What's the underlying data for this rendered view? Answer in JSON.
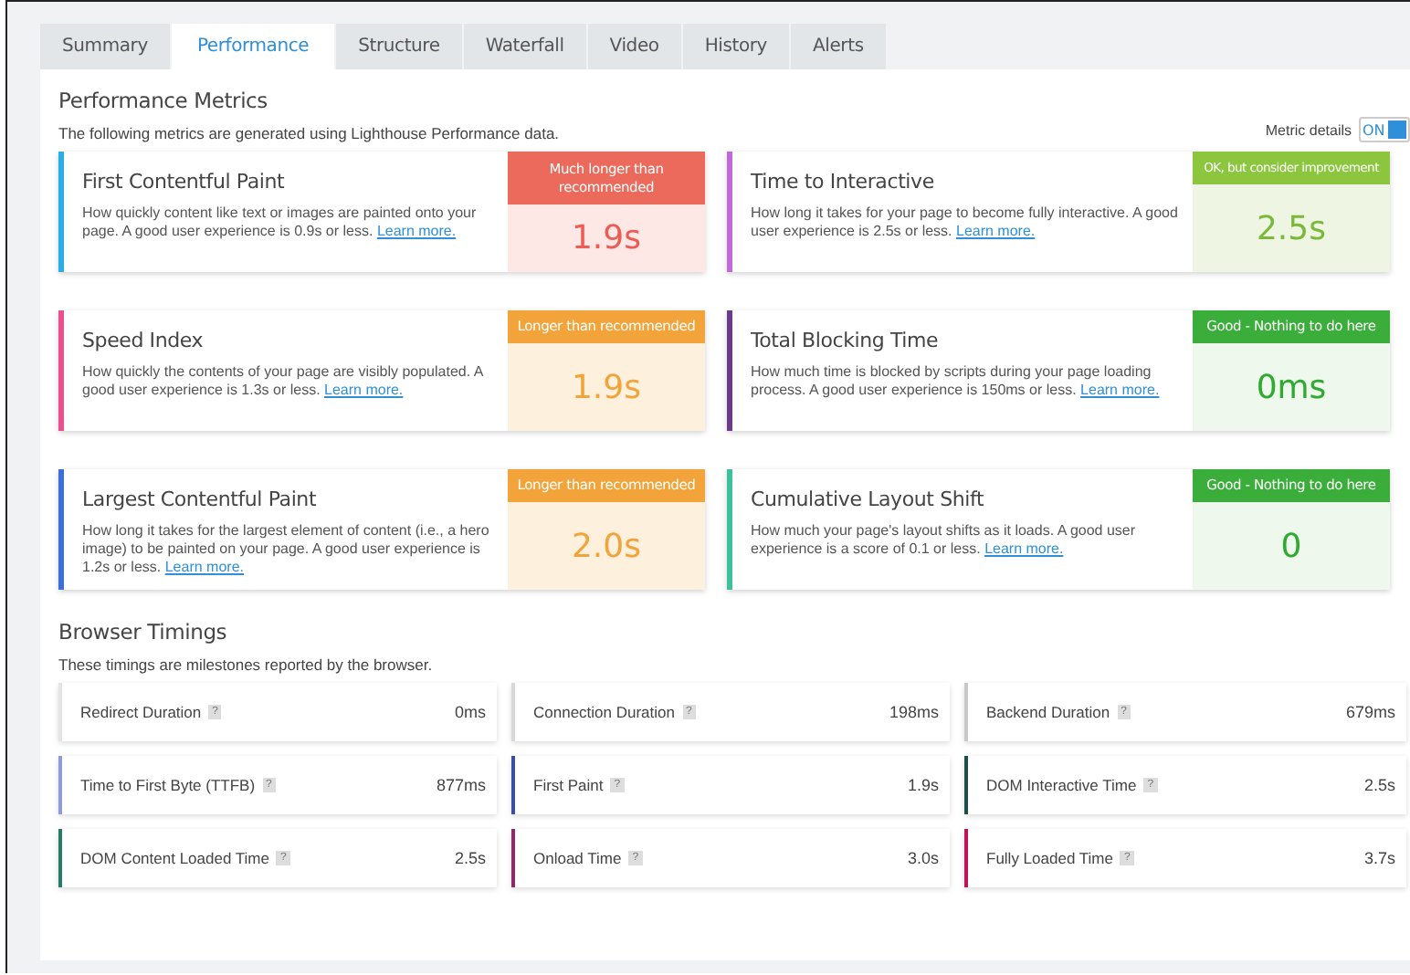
{
  "tabs": [
    {
      "label": "Summary",
      "selected": false
    },
    {
      "label": "Performance",
      "selected": true
    },
    {
      "label": "Structure",
      "selected": false
    },
    {
      "label": "Waterfall",
      "selected": false
    },
    {
      "label": "Video",
      "selected": false
    },
    {
      "label": "History",
      "selected": false
    },
    {
      "label": "Alerts",
      "selected": false
    }
  ],
  "metrics_section": {
    "title": "Performance Metrics",
    "subtitle": "The following metrics are generated using Lighthouse Performance data.",
    "toggle": {
      "label": "Metric details",
      "text": "ON",
      "on": true
    }
  },
  "metrics": [
    {
      "title": "First Contentful Paint",
      "description": "How quickly content like text or images are painted onto your page. A good user experience is 0.9s or less.",
      "link": "Learn more.",
      "color": "#29aee6",
      "kind": "bad",
      "status_label": "Much longer than recommended",
      "value": "1.9s"
    },
    {
      "title": "Time to Interactive",
      "description": "How long it takes for your page to become fully interactive. A good user experience is 2.5s or less.",
      "link": "Learn more.",
      "color": "#c06ad8",
      "kind": "fair",
      "status_label": "OK, but consider improvement",
      "value": "2.5s"
    },
    {
      "title": "Speed Index",
      "description": "How quickly the contents of your page are visibly populated. A good user experience is 1.3s or less.",
      "link": "Learn more.",
      "color": "#e8508f",
      "kind": "average",
      "status_label": "Longer than recommended",
      "value": "1.9s"
    },
    {
      "title": "Total Blocking Time",
      "description": "How much time is blocked by scripts during your page loading process. A good user experience is 150ms or less.",
      "link": "Learn more.",
      "color": "#6b3a8a",
      "kind": "good",
      "status_label": "Good - Nothing to do here",
      "value": "0ms"
    },
    {
      "title": "Largest Contentful Paint",
      "description": "How long it takes for the largest element of content (i.e., a hero image) to be painted on your page. A good user experience is 1.2s or less.",
      "link": "Learn more.",
      "color": "#3d6fd8",
      "kind": "average",
      "status_label": "Longer than recommended",
      "value": "2.0s"
    },
    {
      "title": "Cumulative Layout Shift",
      "description": "How much your page's layout shifts as it loads. A good user experience is a score of 0.1 or less.",
      "link": "Learn more.",
      "color": "#3dc19a",
      "kind": "good",
      "status_label": "Good - Nothing to do here",
      "value": "0"
    }
  ],
  "timings_section": {
    "title": "Browser Timings",
    "subtitle": "These timings are milestones reported by the browser."
  },
  "timings": [
    {
      "label": "Redirect Duration",
      "help": "?",
      "value": "0ms",
      "color": "#e4e4e4"
    },
    {
      "label": "Connection Duration",
      "help": "?",
      "value": "198ms",
      "color": "#d8d8d8"
    },
    {
      "label": "Backend Duration",
      "help": "?",
      "value": "679ms",
      "color": "#c8c8c8"
    },
    {
      "label": "Time to First Byte (TTFB)",
      "help": "?",
      "value": "877ms",
      "color": "#8e9bd6"
    },
    {
      "label": "First Paint",
      "help": "?",
      "value": "1.9s",
      "color": "#3a4f9e"
    },
    {
      "label": "DOM Interactive Time",
      "help": "?",
      "value": "2.5s",
      "color": "#1f4f4a"
    },
    {
      "label": "DOM Content Loaded Time",
      "help": "?",
      "value": "2.5s",
      "color": "#2a7a6a"
    },
    {
      "label": "Onload Time",
      "help": "?",
      "value": "3.0s",
      "color": "#8e2a6a"
    },
    {
      "label": "Fully Loaded Time",
      "help": "?",
      "value": "3.7s",
      "color": "#c0145a"
    }
  ]
}
